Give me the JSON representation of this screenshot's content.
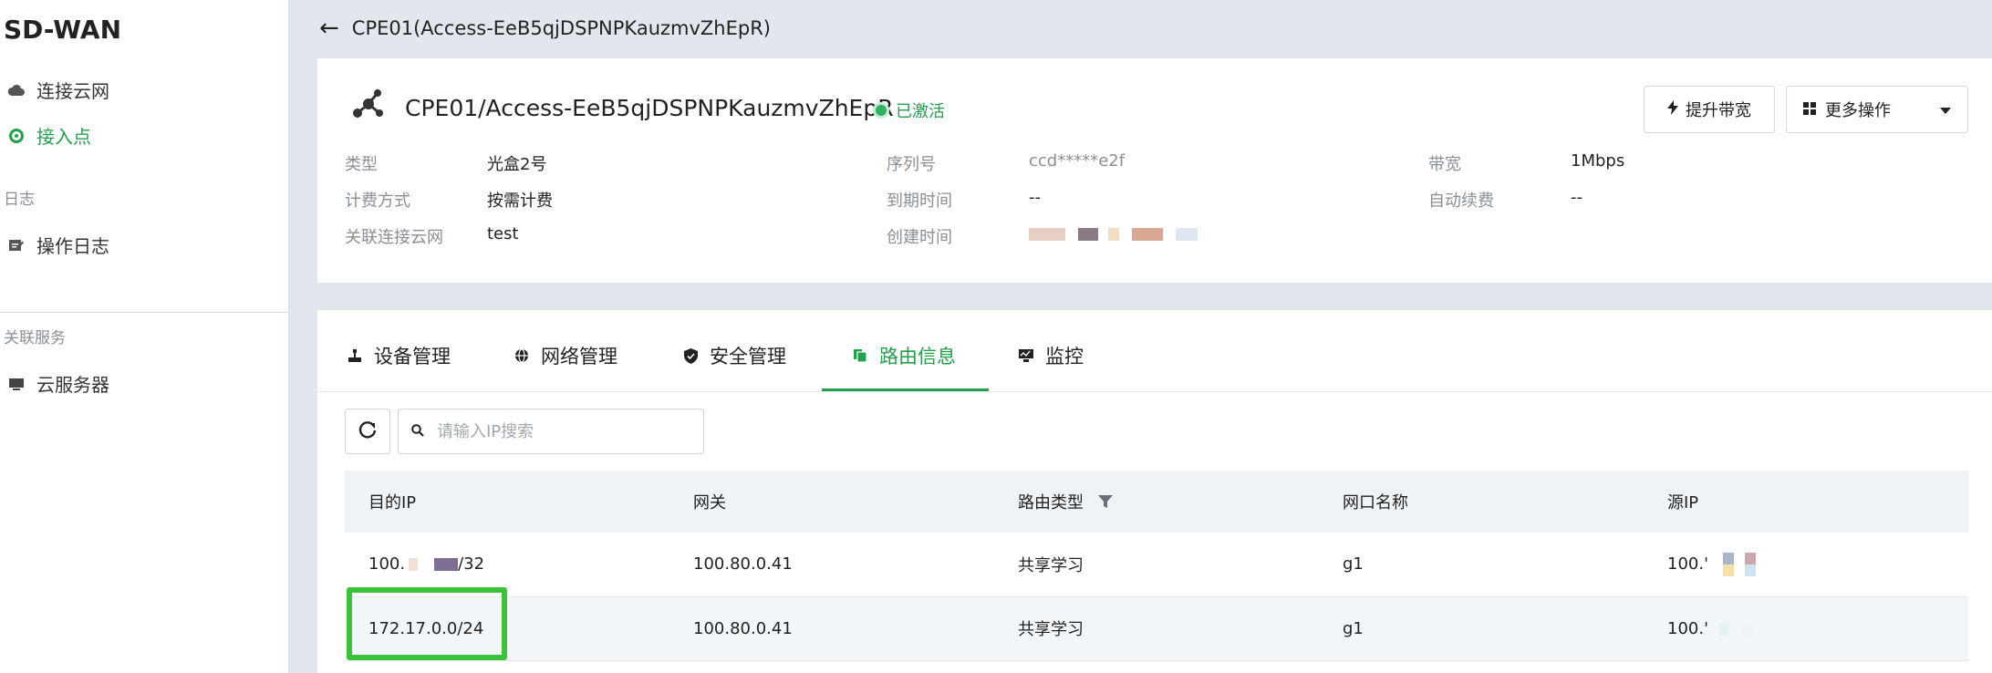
{
  "sidebar": {
    "brand": "SD-WAN",
    "items": [
      {
        "label": "连接云网"
      },
      {
        "label": "接入点"
      }
    ],
    "group_log": "日志",
    "log_item": "操作日志",
    "group_related": "关联服务",
    "related_item": "云服务器"
  },
  "topbar": {
    "back_icon": "arrow-left-icon",
    "title": "CPE01(Access-EeB5qjDSPNPKauzmvZhEpR)"
  },
  "header": {
    "title": "CPE01/Access-EeB5qjDSPNPKauzmvZhEpR",
    "status": "已激活",
    "status_color": "#23a04e",
    "upgrade_button": "提升带宽",
    "more_button": "更多操作",
    "fields": {
      "type_label": "类型",
      "type_value": "光盒2号",
      "billing_label": "计费方式",
      "billing_value": "按需计费",
      "cloud_label": "关联连接云网",
      "cloud_value": "test",
      "serial_label": "序列号",
      "serial_value": "ccd*****e2f",
      "expire_label": "到期时间",
      "expire_value": "--",
      "created_label": "创建时间",
      "bandwidth_label": "带宽",
      "bandwidth_value": "1Mbps",
      "renew_label": "自动续费",
      "renew_value": "--"
    }
  },
  "tabs": [
    {
      "label": "设备管理",
      "icon": "device-icon"
    },
    {
      "label": "网络管理",
      "icon": "globe-icon"
    },
    {
      "label": "安全管理",
      "icon": "shield-icon"
    },
    {
      "label": "路由信息",
      "icon": "route-icon"
    },
    {
      "label": "监控",
      "icon": "monitor-icon"
    }
  ],
  "active_tab": "路由信息",
  "search": {
    "placeholder": "请输入IP搜索"
  },
  "table": {
    "headers": [
      "目的IP",
      "网关",
      "路由类型",
      "网口名称",
      "源IP"
    ],
    "rows": [
      {
        "dest_ip": "100.",
        "dest_ip_suffix": "/32",
        "gateway": "100.80.0.41",
        "route_type": "共享学习",
        "iface": "g1",
        "src_ip": "100.'"
      },
      {
        "dest_ip": "172.17.0.0/24",
        "gateway": "100.80.0.41",
        "route_type": "共享学习",
        "iface": "g1",
        "src_ip": "100.'"
      }
    ]
  },
  "accent": "#23a04e"
}
